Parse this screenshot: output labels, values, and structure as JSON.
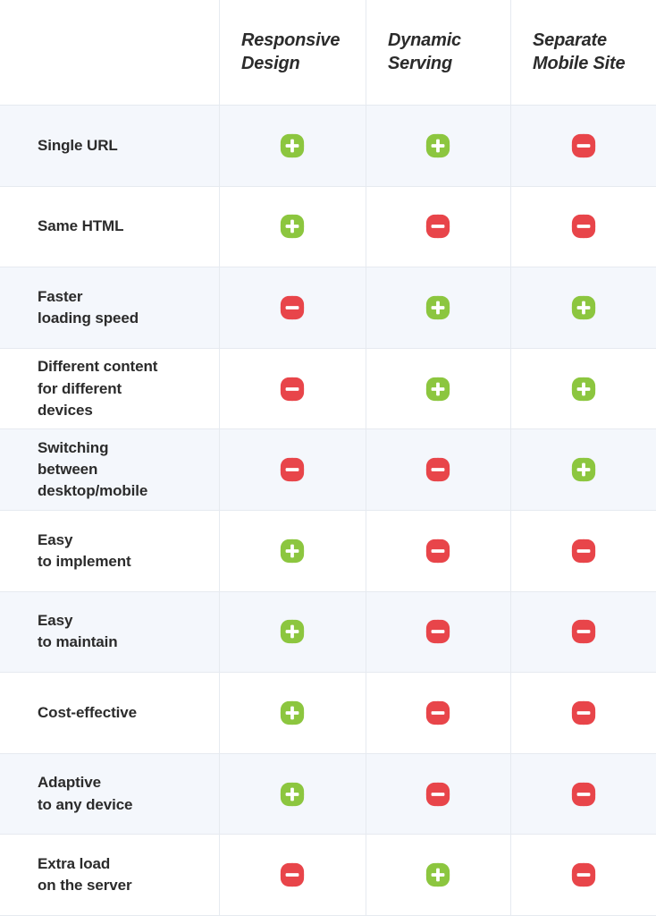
{
  "table": {
    "corner_label": "",
    "columns": [
      {
        "id": "responsive-design",
        "label": "Responsive\nDesign"
      },
      {
        "id": "dynamic-serving",
        "label": "Dynamic\nServing"
      },
      {
        "id": "separate-mobile-site",
        "label": "Separate\nMobile Site"
      }
    ],
    "rows": [
      {
        "label": "Single URL",
        "values": [
          "plus",
          "plus",
          "minus"
        ]
      },
      {
        "label": "Same HTML",
        "values": [
          "plus",
          "minus",
          "minus"
        ]
      },
      {
        "label": "Faster\nloading speed",
        "values": [
          "minus",
          "plus",
          "plus"
        ]
      },
      {
        "label": "Different content\nfor different\ndevices",
        "values": [
          "minus",
          "plus",
          "plus"
        ]
      },
      {
        "label": "Switching\nbetween\ndesktop/mobile",
        "values": [
          "minus",
          "minus",
          "plus"
        ]
      },
      {
        "label": "Easy\nto implement",
        "values": [
          "plus",
          "minus",
          "minus"
        ]
      },
      {
        "label": "Easy\nto maintain",
        "values": [
          "plus",
          "minus",
          "minus"
        ]
      },
      {
        "label": "Cost-effective",
        "values": [
          "plus",
          "minus",
          "minus"
        ]
      },
      {
        "label": "Adaptive\nto any device",
        "values": [
          "plus",
          "minus",
          "minus"
        ]
      },
      {
        "label": "Extra load\non the server",
        "values": [
          "minus",
          "plus",
          "minus"
        ]
      }
    ]
  },
  "icons": {
    "plus": {
      "name": "plus-icon",
      "symbol": "+",
      "meaning": "yes",
      "color": "#8cc63f"
    },
    "minus": {
      "name": "minus-icon",
      "symbol": "−",
      "meaning": "no",
      "color": "#e8454a"
    }
  },
  "colors": {
    "stripe_background": "#f4f7fc",
    "plain_background": "#ffffff",
    "grid_line": "#e6eaf0",
    "text": "#2b2b2b",
    "positive": "#8cc63f",
    "negative": "#e8454a"
  }
}
